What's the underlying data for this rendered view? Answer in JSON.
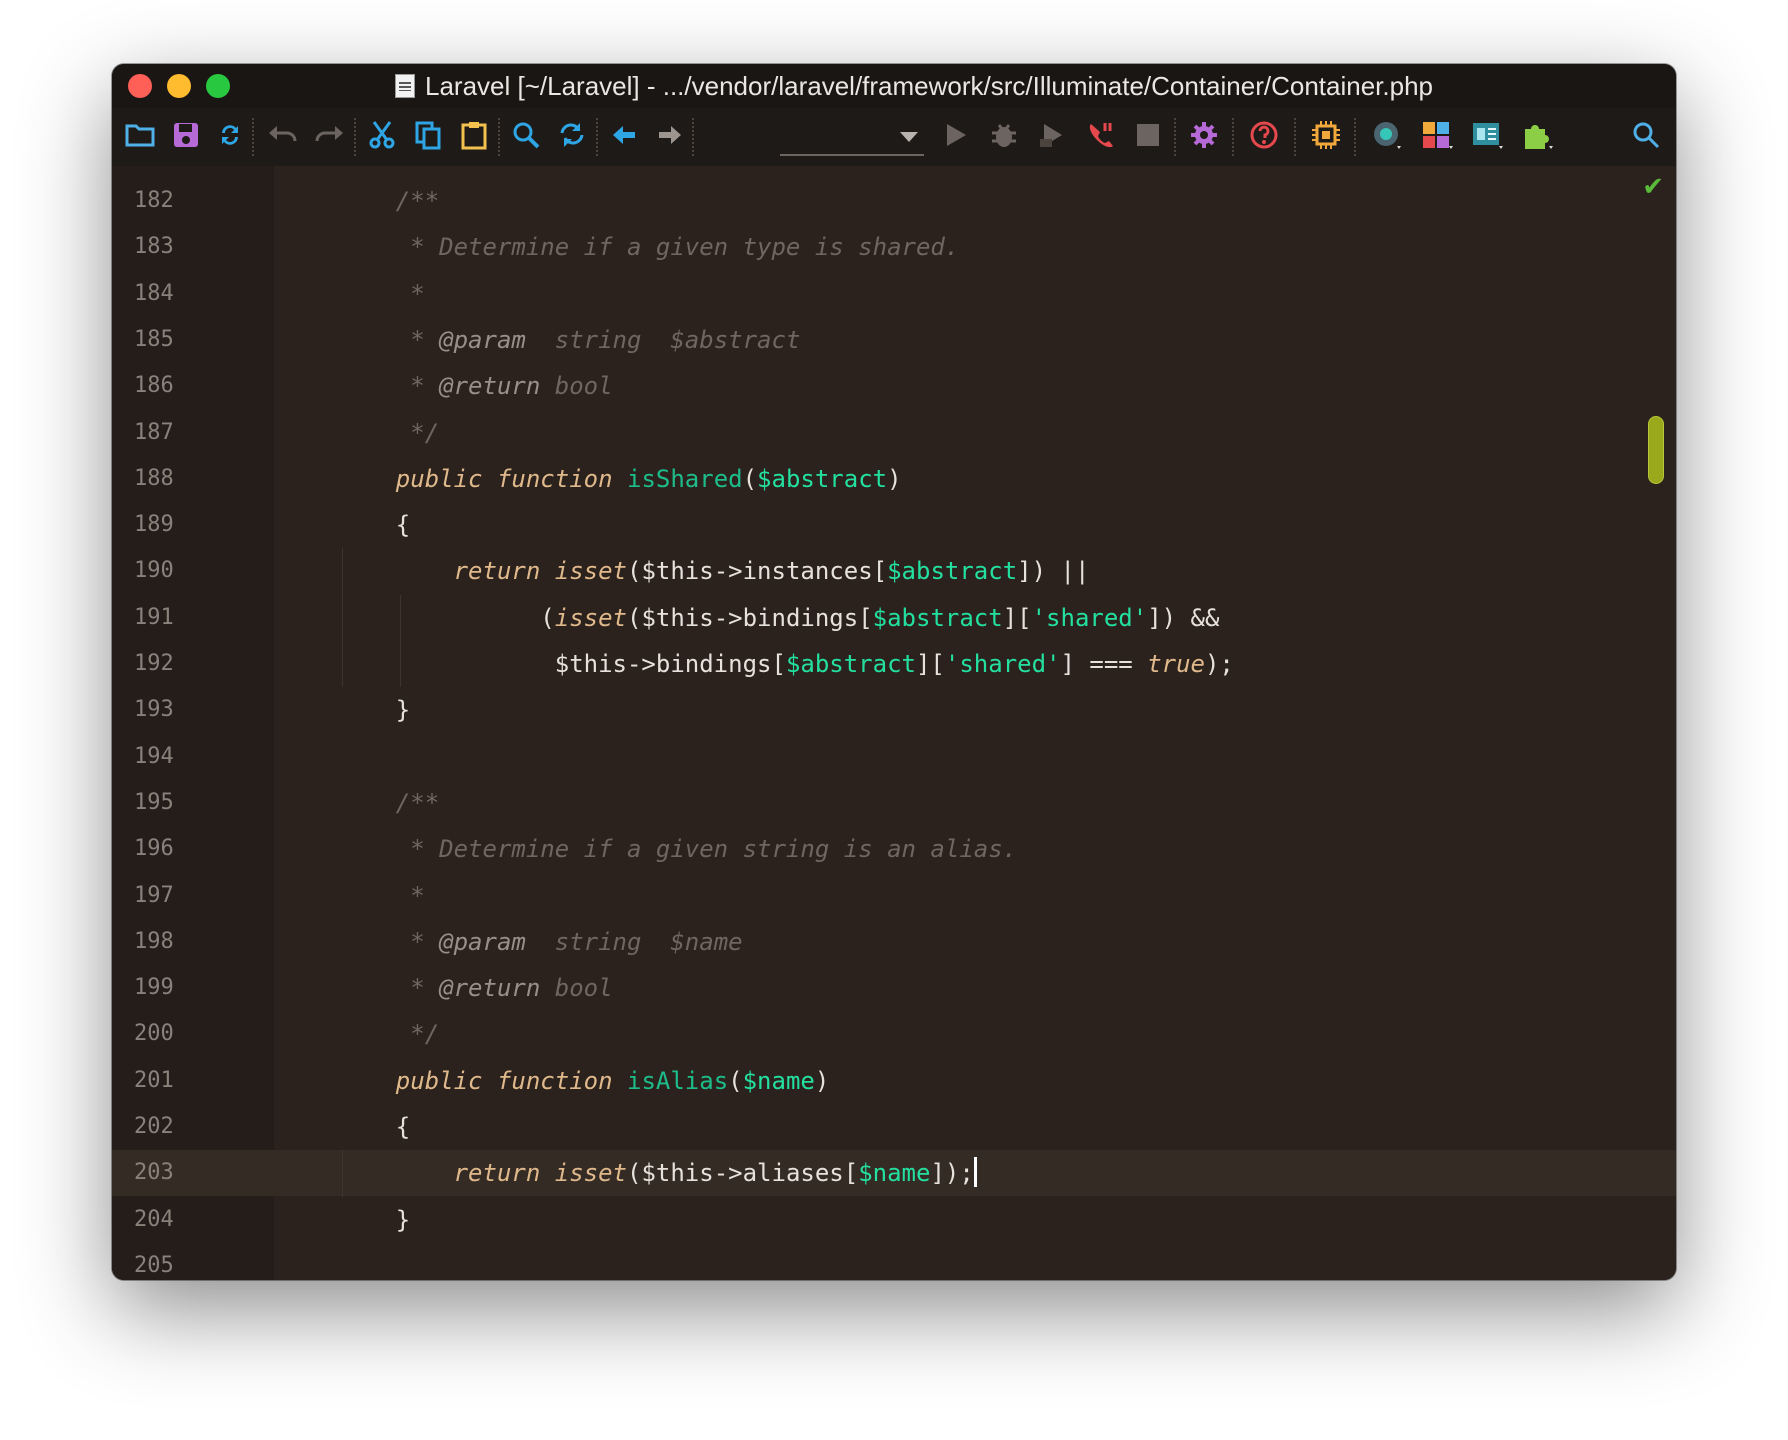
{
  "window": {
    "title": "Laravel [~/Laravel] - .../vendor/laravel/framework/src/Illuminate/Container/Container.php"
  },
  "toolbar": {
    "icons": [
      "open-folder-icon",
      "save-icon",
      "sync-icon",
      "undo-icon",
      "redo-icon",
      "cut-icon",
      "copy-icon",
      "paste-icon",
      "find-icon",
      "replace-icon",
      "back-arrow-icon",
      "forward-arrow-icon",
      "run-config-dropdown",
      "run-icon",
      "debug-icon",
      "coverage-icon",
      "phone-icon",
      "stop-icon",
      "settings-icon",
      "help-icon",
      "cpu-icon",
      "vcs-icon",
      "layout-icon",
      "presentation-icon",
      "plugin-icon",
      "search-icon"
    ],
    "run_config_value": ""
  },
  "colors": {
    "editor_bg": "#2c221d",
    "comment": "#6f6660",
    "keyword": "#dfb98b",
    "function": "#1dbd8b",
    "variable": "#23e0a0",
    "scroll_marker": "#9aa81c"
  },
  "editor": {
    "current_line": 203,
    "lines": [
      {
        "n": "182",
        "segs": [
          [
            "    ",
            "pl"
          ],
          [
            "/**",
            "cm"
          ]
        ]
      },
      {
        "n": "183",
        "segs": [
          [
            "     * Determine if a given type is shared.",
            "cm"
          ]
        ]
      },
      {
        "n": "184",
        "segs": [
          [
            "     *",
            "cm"
          ]
        ]
      },
      {
        "n": "185",
        "segs": [
          [
            "     * ",
            "cm"
          ],
          [
            "@param",
            "tag"
          ],
          [
            "  string  $abstract",
            "cm"
          ]
        ]
      },
      {
        "n": "186",
        "segs": [
          [
            "     * ",
            "cm"
          ],
          [
            "@return",
            "tag"
          ],
          [
            " bool",
            "cm"
          ]
        ]
      },
      {
        "n": "187",
        "segs": [
          [
            "     */",
            "cm"
          ]
        ]
      },
      {
        "n": "188",
        "segs": [
          [
            "    ",
            "pl"
          ],
          [
            "public function",
            "kw"
          ],
          [
            " ",
            "pl"
          ],
          [
            "isShared",
            "fn"
          ],
          [
            "(",
            "pl"
          ],
          [
            "$abstract",
            "var"
          ],
          [
            ")",
            "pl"
          ]
        ]
      },
      {
        "n": "189",
        "segs": [
          [
            "    {",
            "pl"
          ]
        ]
      },
      {
        "n": "190",
        "segs": [
          [
            "        ",
            "pl"
          ],
          [
            "return",
            "kw"
          ],
          [
            " ",
            "pl"
          ],
          [
            "isset",
            "kw"
          ],
          [
            "($this->instances[",
            "pl"
          ],
          [
            "$abstract",
            "var"
          ],
          [
            "]) ||",
            "pl"
          ]
        ]
      },
      {
        "n": "191",
        "segs": [
          [
            "              (",
            "pl"
          ],
          [
            "isset",
            "kw"
          ],
          [
            "($this->bindings[",
            "pl"
          ],
          [
            "$abstract",
            "var"
          ],
          [
            "][",
            "pl"
          ],
          [
            "'shared'",
            "str"
          ],
          [
            "]) &&",
            "pl"
          ]
        ]
      },
      {
        "n": "192",
        "segs": [
          [
            "               $this->bindings[",
            "pl"
          ],
          [
            "$abstract",
            "var"
          ],
          [
            "][",
            "pl"
          ],
          [
            "'shared'",
            "str"
          ],
          [
            "] === ",
            "pl"
          ],
          [
            "true",
            "kw"
          ],
          [
            ");",
            "pl"
          ]
        ]
      },
      {
        "n": "193",
        "segs": [
          [
            "    }",
            "pl"
          ]
        ]
      },
      {
        "n": "194",
        "segs": []
      },
      {
        "n": "195",
        "segs": [
          [
            "    /**",
            "cm"
          ]
        ]
      },
      {
        "n": "196",
        "segs": [
          [
            "     * Determine if a given string is an alias.",
            "cm"
          ]
        ]
      },
      {
        "n": "197",
        "segs": [
          [
            "     *",
            "cm"
          ]
        ]
      },
      {
        "n": "198",
        "segs": [
          [
            "     * ",
            "cm"
          ],
          [
            "@param",
            "tag"
          ],
          [
            "  string  $name",
            "cm"
          ]
        ]
      },
      {
        "n": "199",
        "segs": [
          [
            "     * ",
            "cm"
          ],
          [
            "@return",
            "tag"
          ],
          [
            " bool",
            "cm"
          ]
        ]
      },
      {
        "n": "200",
        "segs": [
          [
            "     */",
            "cm"
          ]
        ]
      },
      {
        "n": "201",
        "segs": [
          [
            "    ",
            "pl"
          ],
          [
            "public function",
            "kw"
          ],
          [
            " ",
            "pl"
          ],
          [
            "isAlias",
            "fn"
          ],
          [
            "(",
            "pl"
          ],
          [
            "$name",
            "var"
          ],
          [
            ")",
            "pl"
          ]
        ]
      },
      {
        "n": "202",
        "segs": [
          [
            "    {",
            "pl"
          ]
        ]
      },
      {
        "n": "203",
        "segs": [
          [
            "        ",
            "pl"
          ],
          [
            "return",
            "kw"
          ],
          [
            " ",
            "pl"
          ],
          [
            "isset",
            "kw"
          ],
          [
            "($this->aliases[",
            "pl"
          ],
          [
            "$name",
            "var"
          ],
          [
            "]);",
            "pl"
          ]
        ]
      },
      {
        "n": "204",
        "segs": [
          [
            "    }",
            "pl"
          ]
        ]
      },
      {
        "n": "205",
        "segs": []
      }
    ]
  }
}
